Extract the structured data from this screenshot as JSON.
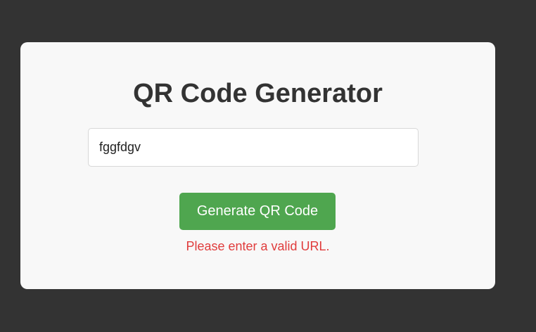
{
  "app": {
    "title": "QR Code Generator"
  },
  "form": {
    "url_input": {
      "value": "fggfdgv",
      "placeholder": ""
    },
    "generate_label": "Generate QR Code",
    "error_message": "Please enter a valid URL."
  },
  "colors": {
    "background": "#333333",
    "card": "#f8f8f8",
    "button": "#4fa64f",
    "error": "#e03c3c",
    "title": "#333333"
  }
}
